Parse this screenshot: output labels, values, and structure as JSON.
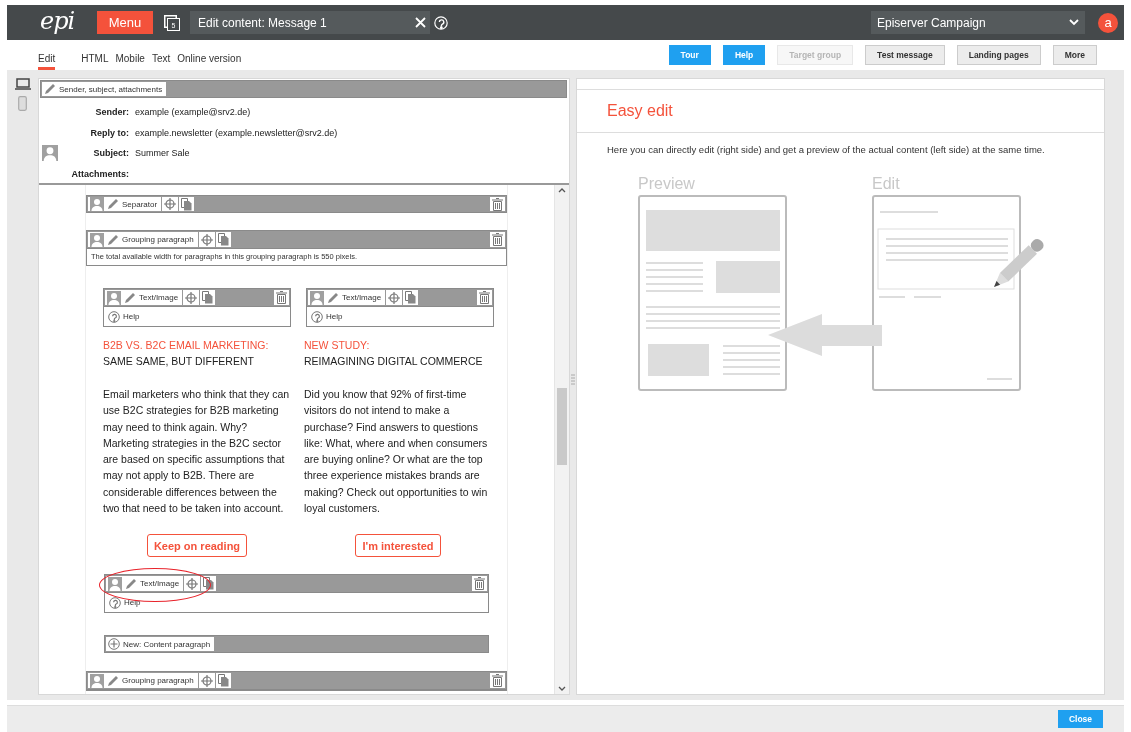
{
  "logo": "epi",
  "topbar": {
    "menu": "Menu",
    "page_count": "5",
    "document_title": "Edit content: Message 1",
    "campaign": "Episerver Campaign",
    "avatar": "a"
  },
  "view_tabs": [
    {
      "label": "Edit",
      "selected": true
    },
    {
      "label": "HTML",
      "selected": false
    },
    {
      "label": "Mobile",
      "selected": false
    },
    {
      "label": "Text",
      "selected": false
    },
    {
      "label": "Online version",
      "selected": false
    }
  ],
  "actions": [
    {
      "label": "Tour",
      "kind": "primary",
      "disabled": false
    },
    {
      "label": "Help",
      "kind": "primary",
      "disabled": false
    },
    {
      "label": "Target group",
      "kind": "default",
      "disabled": true
    },
    {
      "label": "Test message",
      "kind": "default",
      "disabled": false
    },
    {
      "label": "Landing pages",
      "kind": "default",
      "disabled": false
    },
    {
      "label": "More",
      "kind": "default",
      "disabled": false
    }
  ],
  "message_header": {
    "block": "Sender, subject, attachments",
    "fields": [
      {
        "label": "Sender:",
        "value": "example (example@srv2.de)"
      },
      {
        "label": "Reply to:",
        "value": "example.newsletter (example.newsletter@srv2.de)"
      },
      {
        "label": "Subject:",
        "value": "Summer Sale"
      },
      {
        "label": "Attachments:"
      }
    ]
  },
  "blocks": [
    {
      "kind": "separator",
      "label": "Separator",
      "highlighted": false
    },
    {
      "kind": "grouping",
      "label": "Grouping paragraph",
      "note": "The total available width for paragraphs in this grouping paragraph is 550 pixels.",
      "highlighted": false
    },
    {
      "kind": "columns",
      "highlighted": false,
      "columns": [
        {
          "label": "Text/Image",
          "help": "Help",
          "headline": "B2B VS. B2C EMAIL MARKETING:",
          "subheadline": "SAME SAME, BUT DIFFERENT",
          "body": "Email marketers who think that they can use B2C strategies for B2B marketing may need to think again. Why? Marketing strategies in the B2C sector are based on specific assumptions that may not apply to B2B. There are considerable differences between the two that need to be taken into account.",
          "button": "Keep on reading"
        },
        {
          "label": "Text/Image",
          "help": "Help",
          "headline": "NEW STUDY:",
          "subheadline": "REIMAGINING DIGITAL COMMERCE",
          "body": "Did you know that 92% of first-time visitors do not intend to make a purchase? Find answers to questions like: What, where and when consumers are buying online? Or what are the top three experience mistakes brands are making? Check out opportunities to win loyal customers.",
          "button": "I'm interested"
        }
      ]
    },
    {
      "kind": "text_image",
      "label": "Text/Image",
      "help": "Help",
      "highlighted": true
    },
    {
      "kind": "new_paragraph",
      "label": "New: Content paragraph",
      "highlighted": false
    },
    {
      "kind": "grouping",
      "label": "Grouping paragraph",
      "highlighted": false
    }
  ],
  "preview": {
    "title": "Easy edit",
    "description": "Here you can directly edit (right side) and get a preview of the actual content (left side) at the same time.",
    "preview_label": "Preview",
    "edit_label": "Edit"
  },
  "footer": {
    "close": "Close"
  }
}
